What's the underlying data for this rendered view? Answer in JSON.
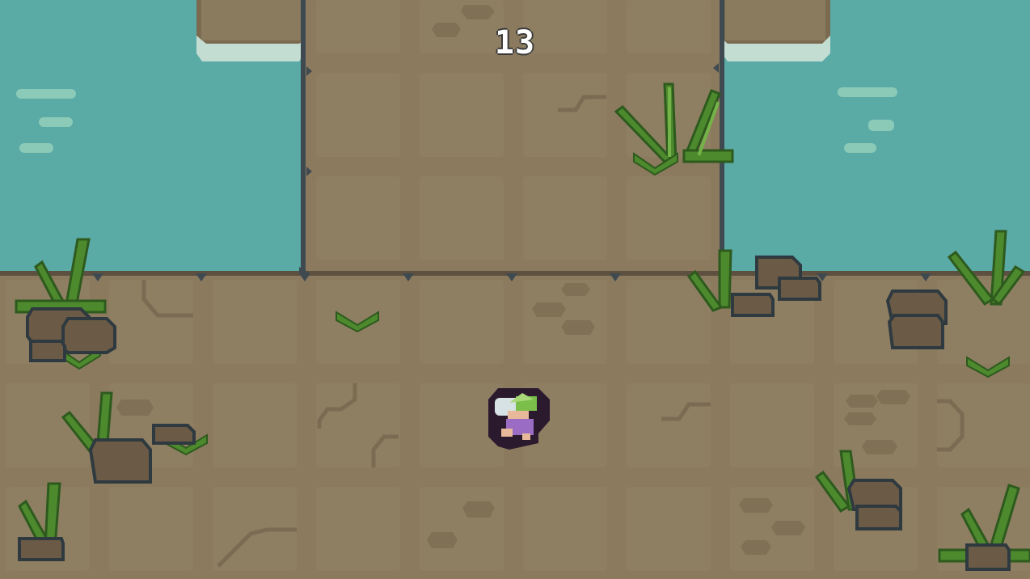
{
  "hud": {
    "score": "13"
  },
  "palette": {
    "water": "#5aaaa6",
    "ground": "#8b7a5e",
    "tile": "#8f7f62",
    "outline": "#3f4a50",
    "plant_dark": "#4d8a2e",
    "plant_light": "#74b347",
    "rock": "#6b5a45",
    "rock_outline": "#2f3a40",
    "foam": "#c4ddd2",
    "player_outline": "#2b1a2e",
    "player_hair": "#7bbf4a",
    "player_dress": "#9a6cc4"
  },
  "icons": [
    "plant-icon",
    "rock-icon",
    "wave-icon",
    "player-icon"
  ]
}
